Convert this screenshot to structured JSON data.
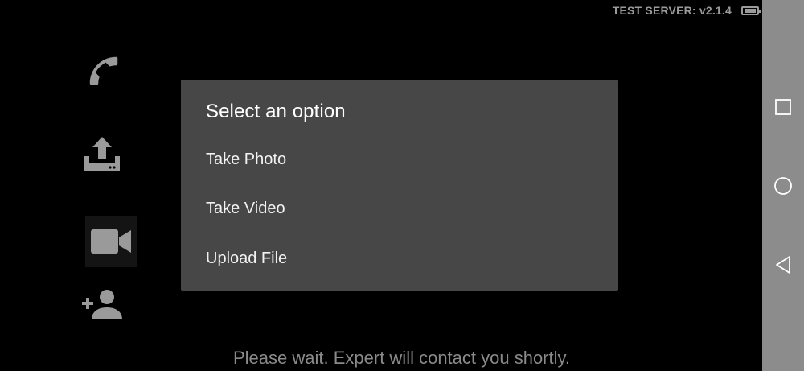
{
  "status": {
    "server_label": "TEST SERVER: v2.1.4",
    "battery_icon": "battery-icon"
  },
  "sidebar": {
    "items": [
      {
        "icon": "phone-icon",
        "name": "call-button"
      },
      {
        "icon": "upload-icon",
        "name": "upload-button"
      },
      {
        "icon": "video-camera-icon",
        "name": "video-button",
        "selected": true
      },
      {
        "icon": "add-person-icon",
        "name": "add-participant-button"
      }
    ]
  },
  "dialog": {
    "title": "Select an option",
    "options": [
      {
        "label": "Take Photo"
      },
      {
        "label": "Take Video"
      },
      {
        "label": "Upload File"
      }
    ]
  },
  "footer": {
    "message": "Please wait. Expert will contact you shortly."
  },
  "navbar": {
    "buttons": [
      "recents-icon",
      "home-icon",
      "back-icon"
    ],
    "color": "#8c8c8c"
  },
  "colors": {
    "background": "#000000",
    "dialog": "#474747",
    "icon": "#9a9a9a"
  }
}
